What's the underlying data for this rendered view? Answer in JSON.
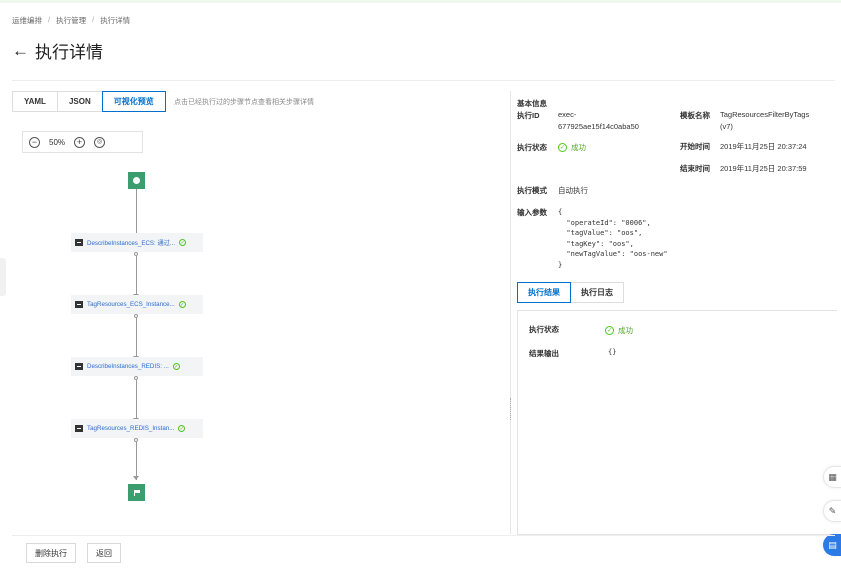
{
  "breadcrumb": [
    "运维编排",
    "执行管理",
    "执行详情"
  ],
  "title": "执行详情",
  "tabs": [
    {
      "label": "YAML",
      "active": false
    },
    {
      "label": "JSON",
      "active": false
    },
    {
      "label": "可视化预览",
      "active": true
    }
  ],
  "hint": "点击已经执行过的步骤节点查看相关步骤详情",
  "zoom": "50%",
  "flow": {
    "nodes": [
      {
        "label": "DescribeInstances_ECS: 通过...",
        "status": "success"
      },
      {
        "label": "TagResources_ECS_Instance...",
        "status": "success"
      },
      {
        "label": "DescribeInstances_REDIS: ...",
        "status": "success"
      },
      {
        "label": "TagResources_REDIS_Instan...",
        "status": "success"
      }
    ]
  },
  "info": {
    "section_title": "基本信息",
    "exec_id_label": "执行ID",
    "exec_id_line1": "exec-",
    "exec_id_line2": "677925ae15f14c0aba50",
    "template_label": "模板名称",
    "template_line1": "TagResourcesFilterByTags",
    "template_line2": "(v7)",
    "status_label": "执行状态",
    "status_value": "成功",
    "start_label": "开始时间",
    "start_value": "2019年11月25日 20:37:24",
    "end_label": "结束时间",
    "end_value": "2019年11月25日 20:37:59",
    "mode_label": "执行模式",
    "mode_value": "自动执行",
    "params_label": "输入参数",
    "params_lines": [
      "{",
      "  \"operateId\": \"0006\",",
      "  \"tagValue\": \"oos\",",
      "  \"tagKey\": \"oos\",",
      "  \"newTagValue\": \"oos-new\"",
      "}"
    ]
  },
  "result_tabs": [
    {
      "label": "执行结果",
      "active": true
    },
    {
      "label": "执行日志",
      "active": false
    }
  ],
  "result": {
    "status_label": "执行状态",
    "status_value": "成功",
    "output_label": "结果输出",
    "output_value": "{}"
  },
  "footer": {
    "delete_label": "删除执行",
    "back_label": "返回"
  },
  "colors": {
    "accent": "#0070cc",
    "success": "#52c41a",
    "node_terminal": "#3c9e6e"
  }
}
